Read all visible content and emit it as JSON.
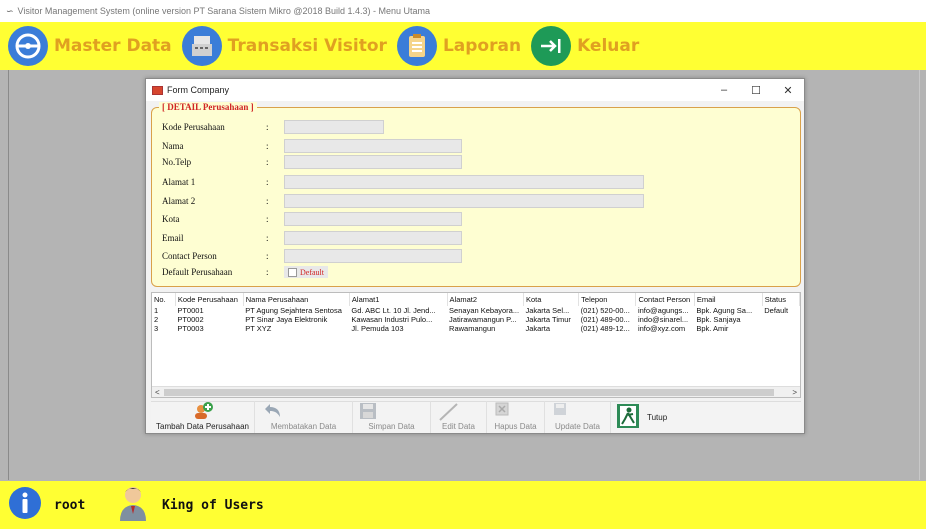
{
  "window_title": "Visitor Management System (online version PT Sarana Sistem Mikro @2018 Build 1.4.3) - Menu Utama",
  "menu": {
    "items": [
      {
        "label": "Master Data",
        "icon": "steering-wheel-icon"
      },
      {
        "label": "Transaksi Visitor",
        "icon": "cash-register-icon"
      },
      {
        "label": "Laporan",
        "icon": "clipboard-icon"
      },
      {
        "label": "Keluar",
        "icon": "exit-arrow-icon"
      }
    ]
  },
  "status": {
    "username": "root",
    "role": "King of Users"
  },
  "form": {
    "title": "Form Company",
    "section_title": "[ DETAIL Perusahaan ]",
    "colon": ":",
    "fields": [
      {
        "label": "Kode Perusahaan",
        "value": ""
      },
      {
        "label": "Nama",
        "value": ""
      },
      {
        "label": "No.Telp",
        "value": ""
      },
      {
        "label": "Alamat 1",
        "value": ""
      },
      {
        "label": "Alamat 2",
        "value": ""
      },
      {
        "label": "Kota",
        "value": ""
      },
      {
        "label": "Email",
        "value": ""
      },
      {
        "label": "Contact Person",
        "value": ""
      },
      {
        "label": "Default Perusahaan",
        "value": ""
      }
    ],
    "default_checkbox_label": "Default",
    "table": {
      "columns": [
        "No.",
        "Kode Perusahaan",
        "Nama Perusahaan",
        "Alamat1",
        "Alamat2",
        "Kota",
        "Telepon",
        "Contact Person",
        "Email",
        "Status"
      ],
      "rows": [
        [
          "1",
          "PT0001",
          "PT Agung Sejahtera Sentosa",
          "Gd. ABC Lt. 10 Jl. Jend...",
          "Senayan Kebayora...",
          "Jakarta Sel...",
          "(021) 520-00...",
          "info@agungs...",
          "Bpk. Agung Sa...",
          "Default"
        ],
        [
          "2",
          "PT0002",
          "PT Sinar Jaya Elektronik",
          "Kawasan Industri Pulo...",
          "Jatirawamangun P...",
          "Jakarta Timur",
          "(021) 489-00...",
          "indo@sinarel...",
          "Bpk. Sanjaya",
          ""
        ],
        [
          "3",
          "PT0003",
          "PT XYZ",
          "Jl. Pemuda 103",
          "Rawamangun",
          "Jakarta",
          "(021) 489-12...",
          "info@xyz.com",
          "Bpk. Amir",
          ""
        ]
      ]
    },
    "toolbar": {
      "add": "Tambah Data Perusahaan",
      "cancel": "Membatakan Data",
      "save": "Simpan Data",
      "edit": "Edit Data",
      "delete": "Hapus Data",
      "update": "Update Data",
      "close": "Tutup"
    }
  }
}
